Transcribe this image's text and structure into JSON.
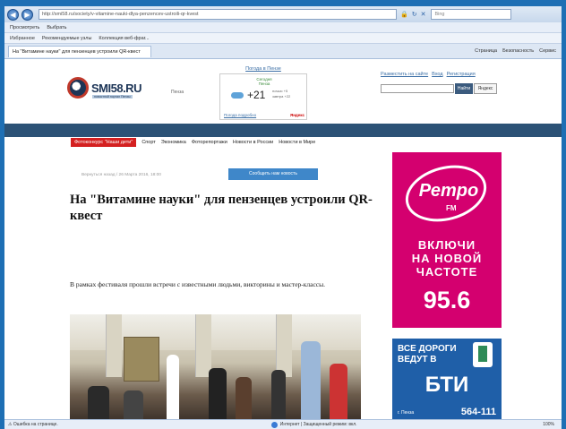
{
  "browser": {
    "url": "http://smi58.ru/society/v-vitamine-nauki-dlya-penzencev-ustroili-qr-kvest",
    "search_placeholder": "Bing",
    "menu": [
      "Просмотреть",
      "Выбрать"
    ],
    "favorites": [
      "Избранное",
      "Рекомендуемые узлы",
      "Коллекция веб-фраг..."
    ],
    "tab_title": "На \"Витамине науки\" для пензенцев устроили QR-квест",
    "commands": [
      "Страница",
      "Безопасность",
      "Сервис"
    ],
    "status_text": "Ошибка на странице.",
    "zone_text": "Интернет | Защищенный режим: вкл.",
    "zoom": "100%"
  },
  "site": {
    "logo": "SMI58.RU",
    "logo_sub": "новостной портал Пензы",
    "city": "Пенза",
    "weather": {
      "header": "Погода в Пензе",
      "today": "Сегодня",
      "city": "Пенза",
      "temp": "+21",
      "night_label": "ночью +5",
      "tomorrow_label": "завтра +22",
      "details_link": "Погода подробно",
      "brand": "Яндекс"
    },
    "top_links": [
      "Разместить на сайте",
      "Вход",
      "Регистрация"
    ],
    "search_button": "Найти",
    "yandex_button": "Яндекс",
    "nav": [
      "Фотоконкурс \"Наши дети\"",
      "Спорт",
      "Экономика",
      "Фоторепортажи",
      "Новости в России",
      "Новости в Мире"
    ]
  },
  "article": {
    "meta": "Вернуться назад / 26 Марта 2016, 18:00",
    "share_button": "Сообщить нам новость",
    "headline": "На \"Витамине науки\" для пензенцев устроили QR-квест",
    "lead": "В рамках фестиваля прошли встречи с известными людьми, викторины и мастер-классы."
  },
  "ads": {
    "retro": {
      "logo": "Ретро",
      "fm": "FM",
      "text_lines": [
        "ВКЛЮЧИ",
        "НА НОВОЙ",
        "ЧАСТОТЕ"
      ],
      "frequency": "95.6"
    },
    "bti": {
      "slogan": "ВСЕ ДОРОГИ ВЕДУТ В",
      "name": "БТИ",
      "city": "г. Пенза",
      "phone": "564-111"
    }
  },
  "colors": {
    "frame": "#1e6fb4",
    "site_bar": "#2c5276",
    "nav_active": "#d42020",
    "share_button": "#3f87c9",
    "retro_ad": "#d4006f",
    "bti_ad": "#1f5fa8"
  }
}
